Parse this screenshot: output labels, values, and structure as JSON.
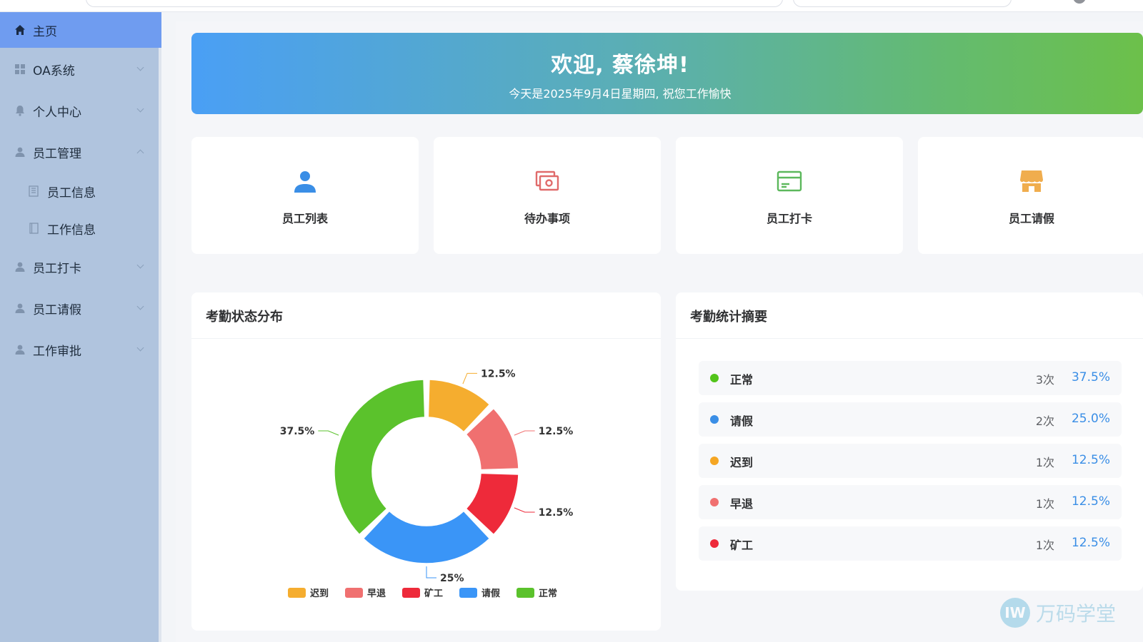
{
  "sidebar": {
    "items": [
      {
        "label": "主页",
        "icon": "home-icon",
        "active": true
      },
      {
        "label": "OA系统",
        "icon": "grid-icon",
        "expanded": false
      },
      {
        "label": "个人中心",
        "icon": "bell-icon",
        "expanded": false
      },
      {
        "label": "员工管理",
        "icon": "user-icon",
        "expanded": true
      },
      {
        "label": "员工打卡",
        "icon": "user-icon",
        "expanded": false
      },
      {
        "label": "员工请假",
        "icon": "user-icon",
        "expanded": false
      },
      {
        "label": "工作审批",
        "icon": "user-icon",
        "expanded": false
      }
    ],
    "subitems": [
      {
        "label": "员工信息",
        "icon": "document-icon"
      },
      {
        "label": "工作信息",
        "icon": "notebook-icon"
      }
    ]
  },
  "banner": {
    "title": "欢迎, 蔡徐坤!",
    "subtitle": "今天是2025年9月4日星期四, 祝您工作愉快"
  },
  "quick_links": [
    {
      "label": "员工列表",
      "icon": "person-icon",
      "color": "#3a8ee6"
    },
    {
      "label": "待办事项",
      "icon": "money-icon",
      "color": "#e06b6b"
    },
    {
      "label": "员工打卡",
      "icon": "credit-card-icon",
      "color": "#5cb85c"
    },
    {
      "label": "员工请假",
      "icon": "shop-icon",
      "color": "#f0ad4e"
    }
  ],
  "chart_panel": {
    "title": "考勤状态分布"
  },
  "summary_panel": {
    "title": "考勤统计摘要",
    "rows": [
      {
        "name": "正常",
        "count": "3次",
        "percent": "37.5%",
        "color": "#52c41a"
      },
      {
        "name": "请假",
        "count": "2次",
        "percent": "25.0%",
        "color": "#3a8ee6"
      },
      {
        "name": "迟到",
        "count": "1次",
        "percent": "12.5%",
        "color": "#f5a623"
      },
      {
        "name": "早退",
        "count": "1次",
        "percent": "12.5%",
        "color": "#f07070"
      },
      {
        "name": "矿工",
        "count": "1次",
        "percent": "12.5%",
        "color": "#ee2a3a"
      }
    ]
  },
  "chart_data": {
    "type": "pie",
    "donut": true,
    "title": "考勤状态分布",
    "categories": [
      "迟到",
      "早退",
      "矿工",
      "请假",
      "正常"
    ],
    "values": [
      1,
      1,
      1,
      2,
      3
    ],
    "labels": [
      "12.5%",
      "12.5%",
      "12.5%",
      "25%",
      "37.5%"
    ],
    "colors": [
      "#f5ad2f",
      "#f07070",
      "#ee2a3a",
      "#3a95f7",
      "#5bc22c"
    ],
    "legend_position": "bottom"
  },
  "watermark": {
    "text": "万码学堂",
    "logo_text": "IW"
  }
}
